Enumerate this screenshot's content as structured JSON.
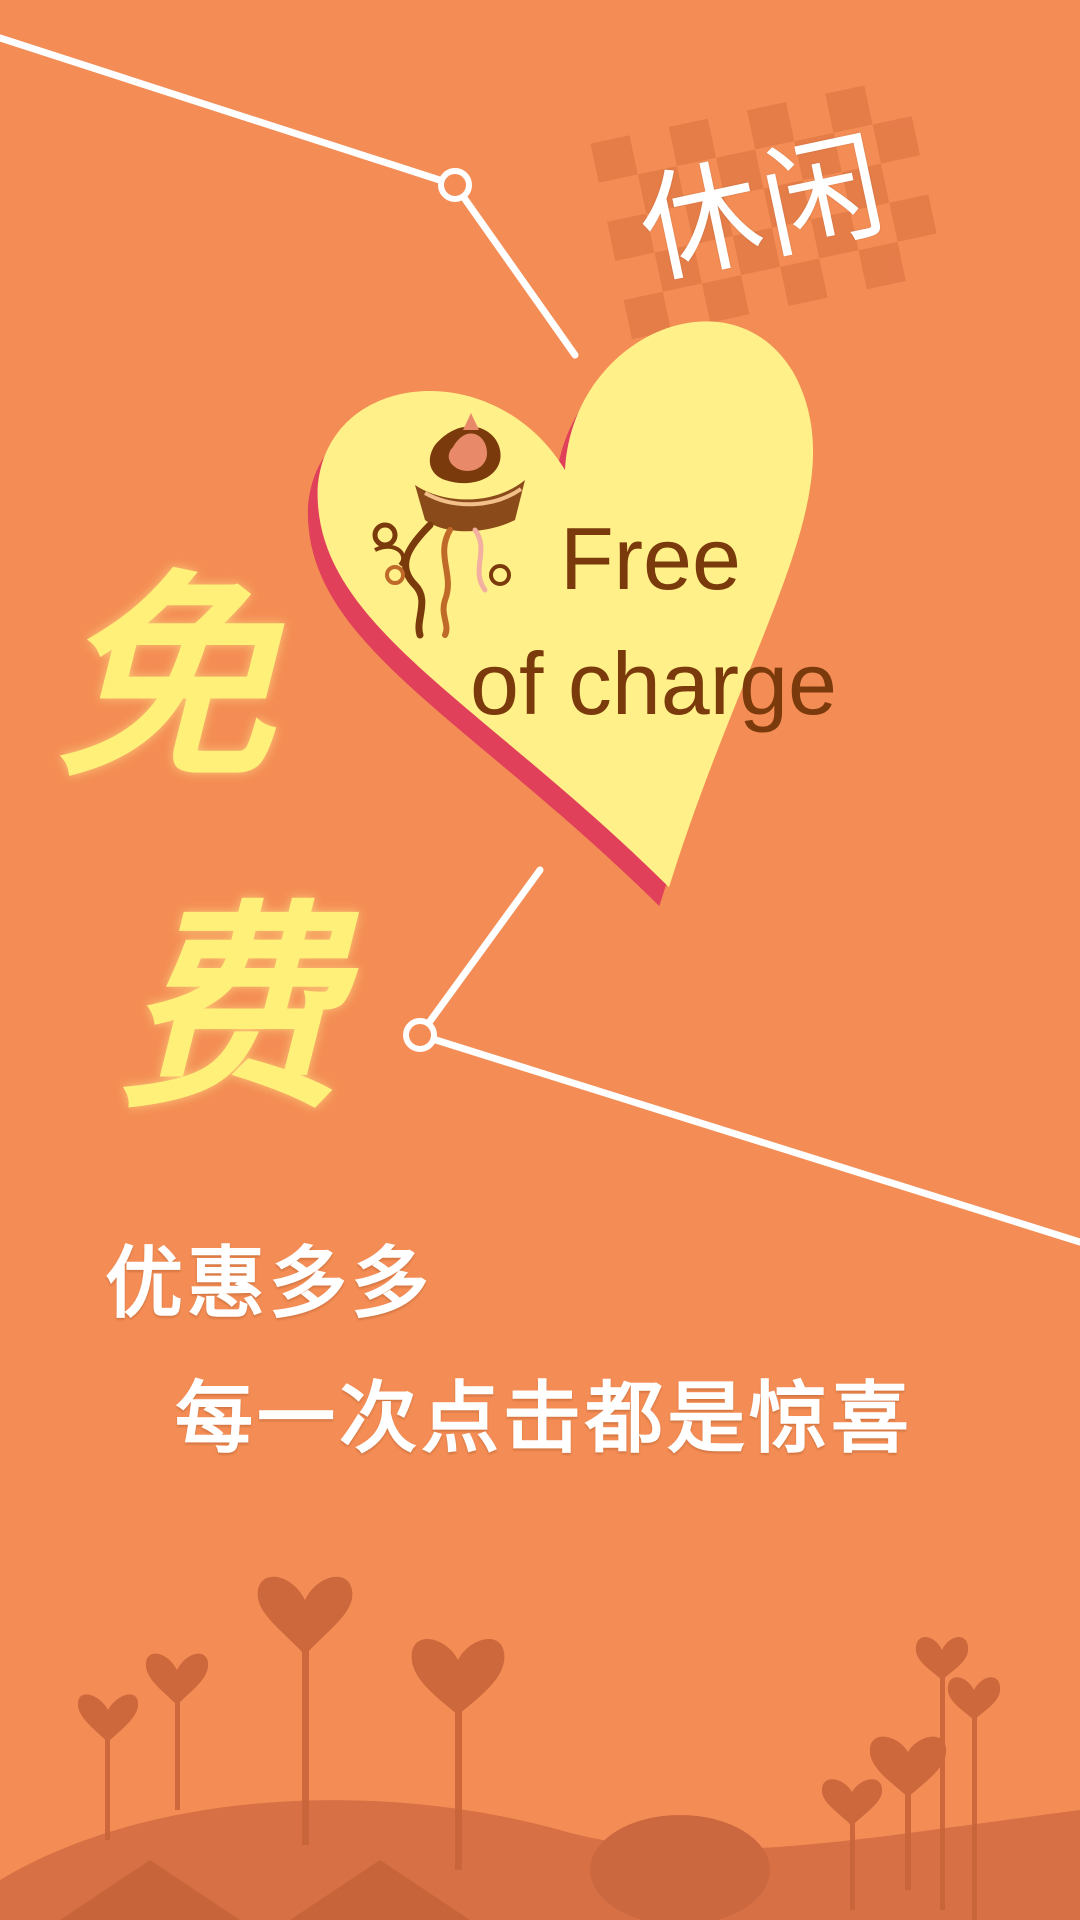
{
  "banner": {
    "tag": "休闲",
    "free_char_1": "免",
    "free_char_2": "费",
    "heart_line_1": "Free",
    "heart_line_2": "of charge",
    "slogan_1": "优惠多多",
    "slogan_2": "每一次点击都是惊喜"
  },
  "colors": {
    "background": "#f48d55",
    "heart_fill": "#fff089",
    "heart_edge": "#e0405a",
    "free_text": "#fff07a",
    "heart_text": "#7a3a0c",
    "silhouette": "#c8643a"
  },
  "icons": [
    "cupcake-icon",
    "heart-lollipop-icon"
  ]
}
